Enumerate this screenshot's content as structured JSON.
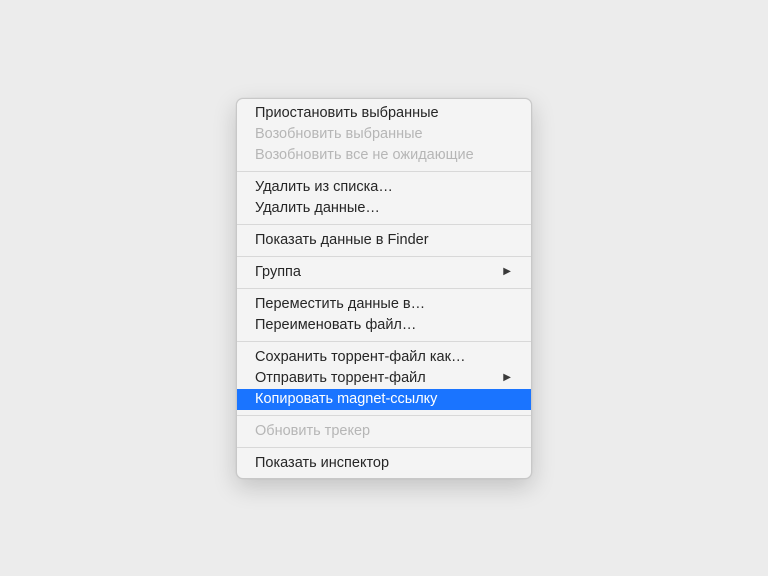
{
  "menu": {
    "pause_selected": "Приостановить выбранные",
    "resume_selected": "Возобновить выбранные",
    "resume_all_not_waiting": "Возобновить все не ожидающие",
    "remove_from_list": "Удалить из списка…",
    "delete_data": "Удалить данные…",
    "show_in_finder": "Показать данные в Finder",
    "group": "Группа",
    "move_data_to": "Переместить данные в…",
    "rename_file": "Переименовать файл…",
    "save_torrent_file_as": "Сохранить торрент-файл как…",
    "send_torrent_file": "Отправить торрент-файл",
    "copy_magnet_link": "Копировать magnet-ссылку",
    "update_tracker": "Обновить трекер",
    "show_inspector": "Показать инспектор"
  }
}
